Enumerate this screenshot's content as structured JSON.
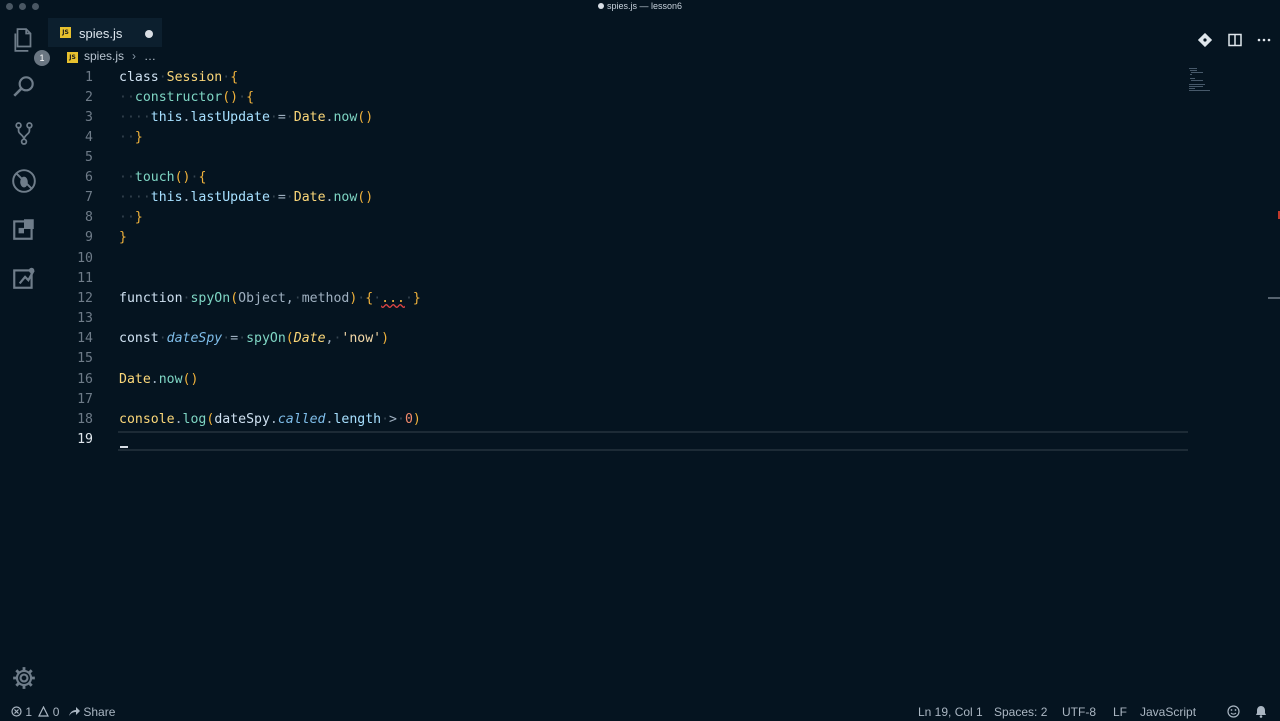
{
  "window": {
    "title": "spies.js — lesson6"
  },
  "activity_bar": {
    "items": [
      {
        "icon": "files-icon",
        "badge": "1"
      },
      {
        "icon": "search-icon"
      },
      {
        "icon": "source-control-icon"
      },
      {
        "icon": "debug-icon"
      },
      {
        "icon": "extensions-icon"
      },
      {
        "icon": "remote-icon"
      }
    ],
    "bottom_icon": "gear-icon"
  },
  "tab": {
    "label": "spies.js",
    "icon_text": "JS",
    "dirty": true
  },
  "editor_actions": [
    "open-changes-icon",
    "split-editor-icon",
    "more-actions-icon"
  ],
  "breadcrumbs": {
    "file": "spies.js",
    "separator": "›",
    "ellipsis": "…"
  },
  "editor": {
    "active_line": 19,
    "lines": [
      {
        "num": "1"
      },
      {
        "num": "2"
      },
      {
        "num": "3"
      },
      {
        "num": "4"
      },
      {
        "num": "5"
      },
      {
        "num": "6"
      },
      {
        "num": "7"
      },
      {
        "num": "8"
      },
      {
        "num": "9"
      },
      {
        "num": "10"
      },
      {
        "num": "11"
      },
      {
        "num": "12"
      },
      {
        "num": "13"
      },
      {
        "num": "14"
      },
      {
        "num": "15"
      },
      {
        "num": "16"
      },
      {
        "num": "17"
      },
      {
        "num": "18"
      },
      {
        "num": "19"
      }
    ],
    "tokens": {
      "l1": [
        "class",
        "Session",
        "{"
      ],
      "l2": [
        "constructor",
        "()",
        "{"
      ],
      "l3": [
        "this",
        ".",
        "lastUpdate",
        "=",
        "Date",
        ".",
        "now",
        "()"
      ],
      "l4": [
        "}"
      ],
      "l6": [
        "touch",
        "()",
        "{"
      ],
      "l7": [
        "this",
        ".",
        "lastUpdate",
        "=",
        "Date",
        ".",
        "now",
        "()"
      ],
      "l8": [
        "}"
      ],
      "l9": [
        "}"
      ],
      "l12": [
        "function",
        "spyOn",
        "(",
        "Object",
        ",",
        "method",
        ")",
        "{",
        "...",
        "}"
      ],
      "l14": [
        "const",
        "dateSpy",
        "=",
        "spyOn",
        "(",
        "Date",
        ",",
        "'now'",
        ")"
      ],
      "l16": [
        "Date",
        ".",
        "now",
        "()"
      ],
      "l18": [
        "console",
        ".",
        "log",
        "(",
        "dateSpy",
        ".",
        "called",
        ".",
        "length",
        ">",
        "0",
        ")"
      ]
    }
  },
  "status_bar": {
    "errors": "1",
    "warnings": "0",
    "share": "Share",
    "position": "Ln 19, Col 1",
    "spaces": "Spaces: 2",
    "encoding": "UTF-8",
    "eol": "LF",
    "language": "JavaScript",
    "icons": [
      "error-icon",
      "warning-icon",
      "share-icon",
      "feedback-icon",
      "bell-icon"
    ]
  },
  "colors": {
    "background": "#051420",
    "accent": "#f0b23c",
    "class": "#fbd779",
    "function": "#7fd6c4",
    "string": "#f3d8a8",
    "number": "#f28a6c"
  }
}
